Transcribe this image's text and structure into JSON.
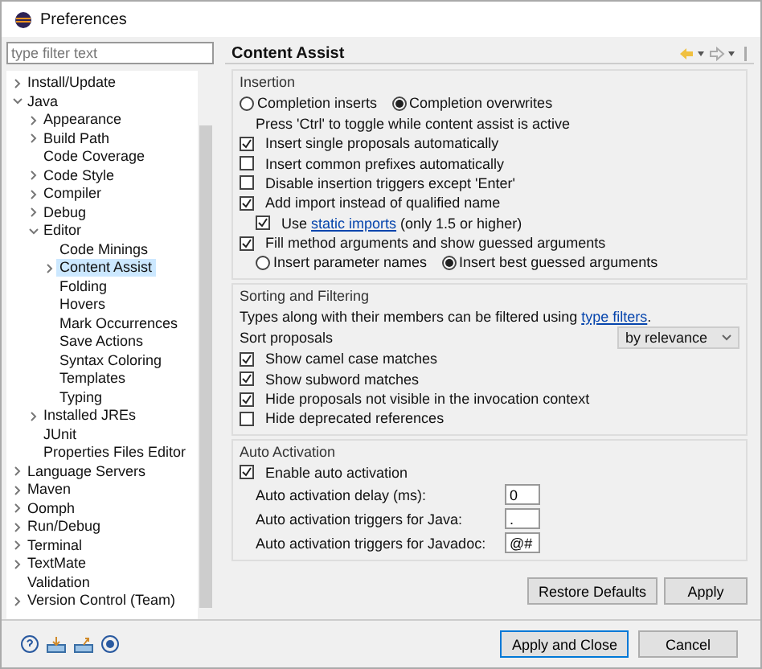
{
  "window": {
    "title": "Preferences"
  },
  "filter": {
    "placeholder": "type filter text"
  },
  "tree": [
    {
      "label": "Install/Update",
      "expanded": false,
      "selected": false
    },
    {
      "label": "Java",
      "expanded": true,
      "selected": false,
      "children": [
        {
          "label": "Appearance",
          "expanded": false,
          "selected": false
        },
        {
          "label": "Build Path",
          "expanded": false,
          "selected": false
        },
        {
          "label": "Code Coverage",
          "selected": false
        },
        {
          "label": "Code Style",
          "expanded": false,
          "selected": false
        },
        {
          "label": "Compiler",
          "expanded": false,
          "selected": false
        },
        {
          "label": "Debug",
          "expanded": false,
          "selected": false
        },
        {
          "label": "Editor",
          "expanded": true,
          "selected": false,
          "children": [
            {
              "label": "Code Minings",
              "selected": false
            },
            {
              "label": "Content Assist",
              "expanded": false,
              "selected": true
            },
            {
              "label": "Folding",
              "selected": false
            },
            {
              "label": "Hovers",
              "selected": false
            },
            {
              "label": "Mark Occurrences",
              "selected": false
            },
            {
              "label": "Save Actions",
              "selected": false
            },
            {
              "label": "Syntax Coloring",
              "selected": false
            },
            {
              "label": "Templates",
              "selected": false
            },
            {
              "label": "Typing",
              "selected": false
            }
          ]
        },
        {
          "label": "Installed JREs",
          "expanded": false,
          "selected": false
        },
        {
          "label": "JUnit",
          "selected": false
        },
        {
          "label": "Properties Files Editor",
          "selected": false
        }
      ]
    },
    {
      "label": "Language Servers",
      "expanded": false,
      "selected": false
    },
    {
      "label": "Maven",
      "expanded": false,
      "selected": false
    },
    {
      "label": "Oomph",
      "expanded": false,
      "selected": false
    },
    {
      "label": "Run/Debug",
      "expanded": false,
      "selected": false
    },
    {
      "label": "Terminal",
      "expanded": false,
      "selected": false
    },
    {
      "label": "TextMate",
      "expanded": false,
      "selected": false
    },
    {
      "label": "Validation",
      "selected": false
    },
    {
      "label": "Version Control (Team)",
      "expanded": false,
      "selected": false
    }
  ],
  "page": {
    "title": "Content Assist"
  },
  "insertion": {
    "title": "Insertion",
    "items": [
      {
        "kind": "radios",
        "options": [
          {
            "label": "Completion inserts",
            "selected": false
          },
          {
            "label": "Completion overwrites",
            "selected": true
          }
        ]
      },
      {
        "kind": "note",
        "text": "Press 'Ctrl' to toggle while content assist is active"
      },
      {
        "kind": "checkbox",
        "label": "Insert single proposals automatically",
        "checked": true
      },
      {
        "kind": "checkbox",
        "label": "Insert common prefixes automatically",
        "checked": false
      },
      {
        "kind": "checkbox",
        "label": "Disable insertion triggers except 'Enter'",
        "checked": false
      },
      {
        "kind": "checkbox",
        "label": "Add import instead of qualified name",
        "checked": true,
        "children": [
          {
            "kind": "checkbox",
            "label": "Use ",
            "link": "static imports",
            "after": " (only 1.5 or higher)",
            "checked": true
          }
        ]
      },
      {
        "kind": "checkbox",
        "label": "Fill method arguments and show guessed arguments",
        "checked": true,
        "children": [
          {
            "kind": "radios",
            "options": [
              {
                "label": "Insert parameter names",
                "selected": false
              },
              {
                "label": "Insert best guessed arguments",
                "selected": true
              }
            ]
          }
        ]
      }
    ]
  },
  "sorting": {
    "title": "Sorting and Filtering",
    "hint": "Types along with their members can be filtered using ",
    "link": "type filters",
    "after": ".",
    "sort": {
      "label": "Sort proposals",
      "value": "by relevance"
    },
    "items": [
      {
        "label": "Show camel case matches",
        "checked": true
      },
      {
        "label": "Show subword matches",
        "checked": true
      },
      {
        "label": "Hide proposals not visible in the invocation context",
        "checked": true
      },
      {
        "label": "Hide deprecated references",
        "checked": false
      }
    ]
  },
  "auto": {
    "title": "Auto Activation",
    "enable": {
      "label": "Enable auto activation",
      "checked": true
    },
    "fields": [
      {
        "label": "Auto activation delay (ms):",
        "value": "0"
      },
      {
        "label": "Auto activation triggers for Java:",
        "value": "."
      },
      {
        "label": "Auto activation triggers for Javadoc:",
        "value": "@#"
      }
    ]
  },
  "page_buttons": [
    "Restore Defaults",
    "Apply"
  ],
  "dialog_buttons": [
    {
      "label": "Apply and Close",
      "default": true
    },
    {
      "label": "Cancel",
      "default": false
    }
  ]
}
